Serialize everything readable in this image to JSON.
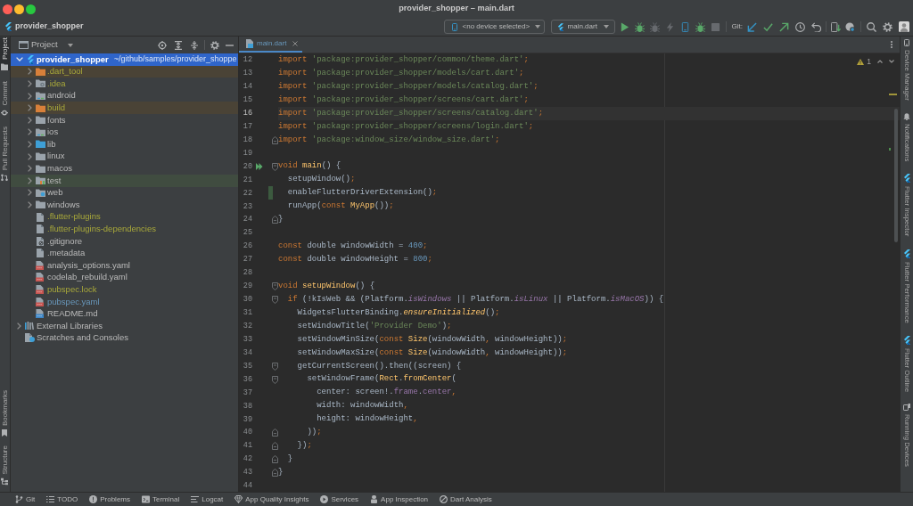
{
  "window": {
    "title": "provider_shopper – main.dart"
  },
  "toolbar": {
    "project_name": "provider_shopper",
    "device_selector": "<no device selected>",
    "run_configuration": "main.dart",
    "run_actions": [
      {
        "disabled": false
      },
      {
        "disabled": false
      },
      {
        "disabled": true
      },
      {
        "disabled": true
      },
      {
        "disabled": false
      },
      {
        "disabled": false
      },
      {
        "disabled": true
      }
    ],
    "git_label": "Git:"
  },
  "left_tool_strip": {
    "top": [
      {
        "label": "Project",
        "selected": true
      },
      {
        "label": "Commit",
        "selected": false
      },
      {
        "label": "Pull Requests",
        "selected": false
      }
    ],
    "bottom": [
      {
        "label": "Bookmarks",
        "selected": false
      },
      {
        "label": "Structure",
        "selected": false
      }
    ]
  },
  "project_panel": {
    "title": "Project",
    "tree": [
      {
        "name": "provider_shopper",
        "path": "~/github/samples/provider_shoppe",
        "kind": "module",
        "expanded": true,
        "selected": true,
        "children": [
          {
            "name": ".dart_tool",
            "kind": "excluded_folder",
            "ignored": true,
            "expanded": false,
            "selected": false
          },
          {
            "name": ".idea",
            "kind": "config_folder",
            "ignored": true,
            "expanded": false,
            "selected": false
          },
          {
            "name": "android",
            "kind": "module_folder",
            "expanded": false,
            "selected": false
          },
          {
            "name": "build",
            "kind": "excluded_folder",
            "ignored": true,
            "expanded": false,
            "selected": false
          },
          {
            "name": "fonts",
            "kind": "folder",
            "expanded": false,
            "selected": false
          },
          {
            "name": "ios",
            "kind": "module_folder",
            "expanded": false,
            "selected": false
          },
          {
            "name": "lib",
            "kind": "source_folder",
            "expanded": false,
            "selected": false
          },
          {
            "name": "linux",
            "kind": "folder",
            "expanded": false,
            "selected": false
          },
          {
            "name": "macos",
            "kind": "folder",
            "expanded": false,
            "selected": false
          },
          {
            "name": "test",
            "kind": "test_folder",
            "expanded": false,
            "selected": false
          },
          {
            "name": "web",
            "kind": "web_folder",
            "expanded": false,
            "selected": false
          },
          {
            "name": "windows",
            "kind": "folder",
            "expanded": false,
            "selected": false
          },
          {
            "name": ".flutter-plugins",
            "kind": "file",
            "ignored": true,
            "selected": false
          },
          {
            "name": ".flutter-plugins-dependencies",
            "kind": "file",
            "ignored": true,
            "selected": false
          },
          {
            "name": ".gitignore",
            "kind": "ignore_file",
            "selected": false
          },
          {
            "name": ".metadata",
            "kind": "file",
            "selected": false
          },
          {
            "name": "analysis_options.yaml",
            "kind": "yaml_file",
            "selected": false
          },
          {
            "name": "codelab_rebuild.yaml",
            "kind": "yaml_file",
            "selected": false
          },
          {
            "name": "pubspec.lock",
            "kind": "yaml_file",
            "ignored": true,
            "selected": false
          },
          {
            "name": "pubspec.yaml",
            "kind": "yaml_file",
            "modified": true,
            "selected": false
          },
          {
            "name": "README.md",
            "kind": "markdown_file",
            "selected": false
          }
        ]
      },
      {
        "name": "External Libraries",
        "kind": "libraries",
        "expanded": false,
        "selected": false
      },
      {
        "name": "Scratches and Consoles",
        "kind": "scratches",
        "selected": false
      }
    ]
  },
  "editor": {
    "tabs": [
      {
        "label": "main.dart",
        "selected": true,
        "modified": true
      }
    ],
    "warning_count": "1",
    "lines": [
      {
        "number": "12",
        "current": false,
        "tokens": [
          {
            "kind": "keyword",
            "text": "import "
          },
          {
            "kind": "string",
            "text": "'package:provider_shopper/common/theme.dart'"
          },
          {
            "kind": "punctuation",
            "text": ";"
          }
        ]
      },
      {
        "number": "13",
        "current": false,
        "tokens": [
          {
            "kind": "keyword",
            "text": "import "
          },
          {
            "kind": "string",
            "text": "'package:provider_shopper/models/cart.dart'"
          },
          {
            "kind": "punctuation",
            "text": ";"
          }
        ]
      },
      {
        "number": "14",
        "current": false,
        "tokens": [
          {
            "kind": "keyword",
            "text": "import "
          },
          {
            "kind": "string",
            "text": "'package:provider_shopper/models/catalog.dart'"
          },
          {
            "kind": "punctuation",
            "text": ";"
          }
        ]
      },
      {
        "number": "15",
        "current": false,
        "tokens": [
          {
            "kind": "keyword",
            "text": "import "
          },
          {
            "kind": "string",
            "text": "'package:provider_shopper/screens/cart.dart'"
          },
          {
            "kind": "punctuation",
            "text": ";"
          }
        ]
      },
      {
        "number": "16",
        "current": true,
        "tokens": [
          {
            "kind": "keyword",
            "text": "import "
          },
          {
            "kind": "string",
            "text": "'package:provider_shopper/screens/catalog.dart'"
          },
          {
            "kind": "punctuation",
            "text": ";"
          }
        ]
      },
      {
        "number": "17",
        "current": false,
        "tokens": [
          {
            "kind": "keyword",
            "text": "import "
          },
          {
            "kind": "string",
            "text": "'package:provider_shopper/screens/login.dart'"
          },
          {
            "kind": "punctuation",
            "text": ";"
          }
        ]
      },
      {
        "number": "18",
        "current": false,
        "fold_end": true,
        "tokens": [
          {
            "kind": "keyword",
            "text": "import "
          },
          {
            "kind": "string",
            "text": "'package:window_size/window_size.dart'"
          },
          {
            "kind": "punctuation",
            "text": ";"
          }
        ]
      },
      {
        "number": "19",
        "current": false
      },
      {
        "number": "20",
        "current": false,
        "fold_start": true,
        "run_marker": true,
        "tokens": [
          {
            "kind": "keyword",
            "text": "void "
          },
          {
            "kind": "declaration",
            "text": "main"
          },
          {
            "kind": "plain",
            "text": "() {"
          }
        ]
      },
      {
        "number": "21",
        "current": false,
        "tokens": [
          {
            "kind": "plain",
            "text": "  setupWindow()"
          },
          {
            "kind": "punctuation",
            "text": ";"
          }
        ]
      },
      {
        "number": "22",
        "current": false,
        "changed": true,
        "tokens": [
          {
            "kind": "plain",
            "text": "  enableFlutterDriverExtension()"
          },
          {
            "kind": "punctuation",
            "text": ";"
          }
        ]
      },
      {
        "number": "23",
        "current": false,
        "tokens": [
          {
            "kind": "plain",
            "text": "  runApp("
          },
          {
            "kind": "keyword",
            "text": "const "
          },
          {
            "kind": "type",
            "text": "MyApp"
          },
          {
            "kind": "plain",
            "text": "())"
          },
          {
            "kind": "punctuation",
            "text": ";"
          }
        ]
      },
      {
        "number": "24",
        "current": false,
        "fold_end": true,
        "tokens": [
          {
            "kind": "plain",
            "text": "}"
          }
        ]
      },
      {
        "number": "25",
        "current": false
      },
      {
        "number": "26",
        "current": false,
        "tokens": [
          {
            "kind": "keyword",
            "text": "const "
          },
          {
            "kind": "plain",
            "text": "double windowWidth = "
          },
          {
            "kind": "number",
            "text": "400"
          },
          {
            "kind": "punctuation",
            "text": ";"
          }
        ]
      },
      {
        "number": "27",
        "current": false,
        "tokens": [
          {
            "kind": "keyword",
            "text": "const "
          },
          {
            "kind": "plain",
            "text": "double windowHeight = "
          },
          {
            "kind": "number",
            "text": "800"
          },
          {
            "kind": "punctuation",
            "text": ";"
          }
        ]
      },
      {
        "number": "28",
        "current": false
      },
      {
        "number": "29",
        "current": false,
        "fold_start": true,
        "tokens": [
          {
            "kind": "keyword",
            "text": "void "
          },
          {
            "kind": "declaration",
            "text": "setupWindow"
          },
          {
            "kind": "plain",
            "text": "() {"
          }
        ]
      },
      {
        "number": "30",
        "current": false,
        "fold_start": true,
        "tokens": [
          {
            "kind": "keyword",
            "text": "  if "
          },
          {
            "kind": "plain",
            "text": "(!kIsWeb && (Platform."
          },
          {
            "kind": "static_property",
            "text": "isWindows"
          },
          {
            "kind": "plain",
            "text": " || Platform."
          },
          {
            "kind": "static_property",
            "text": "isLinux"
          },
          {
            "kind": "plain",
            "text": " || Platform."
          },
          {
            "kind": "static_property",
            "text": "isMacOS"
          },
          {
            "kind": "plain",
            "text": ")) {"
          }
        ]
      },
      {
        "number": "31",
        "current": false,
        "tokens": [
          {
            "kind": "plain",
            "text": "    WidgetsFlutterBinding."
          },
          {
            "kind": "static_method",
            "text": "ensureInitialized"
          },
          {
            "kind": "plain",
            "text": "()"
          },
          {
            "kind": "punctuation",
            "text": ";"
          }
        ]
      },
      {
        "number": "32",
        "current": false,
        "tokens": [
          {
            "kind": "plain",
            "text": "    setWindowTitle("
          },
          {
            "kind": "string",
            "text": "'Provider Demo'"
          },
          {
            "kind": "plain",
            "text": ")"
          },
          {
            "kind": "punctuation",
            "text": ";"
          }
        ]
      },
      {
        "number": "33",
        "current": false,
        "tokens": [
          {
            "kind": "plain",
            "text": "    setWindowMinSize("
          },
          {
            "kind": "keyword",
            "text": "const "
          },
          {
            "kind": "type",
            "text": "Size"
          },
          {
            "kind": "plain",
            "text": "(windowWidth"
          },
          {
            "kind": "punctuation",
            "text": ","
          },
          {
            "kind": "plain",
            "text": " windowHeight))"
          },
          {
            "kind": "punctuation",
            "text": ";"
          }
        ]
      },
      {
        "number": "34",
        "current": false,
        "tokens": [
          {
            "kind": "plain",
            "text": "    setWindowMaxSize("
          },
          {
            "kind": "keyword",
            "text": "const "
          },
          {
            "kind": "type",
            "text": "Size"
          },
          {
            "kind": "plain",
            "text": "(windowWidth"
          },
          {
            "kind": "punctuation",
            "text": ","
          },
          {
            "kind": "plain",
            "text": " windowHeight))"
          },
          {
            "kind": "punctuation",
            "text": ";"
          }
        ]
      },
      {
        "number": "35",
        "current": false,
        "fold_start": true,
        "tokens": [
          {
            "kind": "plain",
            "text": "    getCurrentScreen().then((screen) {"
          }
        ]
      },
      {
        "number": "36",
        "current": false,
        "fold_start": true,
        "tokens": [
          {
            "kind": "plain",
            "text": "      setWindowFrame("
          },
          {
            "kind": "type",
            "text": "Rect"
          },
          {
            "kind": "plain",
            "text": "."
          },
          {
            "kind": "type",
            "text": "fromCenter"
          },
          {
            "kind": "plain",
            "text": "("
          }
        ]
      },
      {
        "number": "37",
        "current": false,
        "tokens": [
          {
            "kind": "plain",
            "text": "        center: screen!."
          },
          {
            "kind": "property",
            "text": "frame"
          },
          {
            "kind": "plain",
            "text": "."
          },
          {
            "kind": "property",
            "text": "center"
          },
          {
            "kind": "punctuation",
            "text": ","
          }
        ]
      },
      {
        "number": "38",
        "current": false,
        "tokens": [
          {
            "kind": "plain",
            "text": "        width: windowWidth"
          },
          {
            "kind": "punctuation",
            "text": ","
          }
        ]
      },
      {
        "number": "39",
        "current": false,
        "tokens": [
          {
            "kind": "plain",
            "text": "        height: windowHeight"
          },
          {
            "kind": "punctuation",
            "text": ","
          }
        ]
      },
      {
        "number": "40",
        "current": false,
        "fold_end": true,
        "tokens": [
          {
            "kind": "plain",
            "text": "      ))"
          },
          {
            "kind": "punctuation",
            "text": ";"
          }
        ]
      },
      {
        "number": "41",
        "current": false,
        "fold_end": true,
        "tokens": [
          {
            "kind": "plain",
            "text": "    })"
          },
          {
            "kind": "punctuation",
            "text": ";"
          }
        ]
      },
      {
        "number": "42",
        "current": false,
        "fold_end": true,
        "tokens": [
          {
            "kind": "plain",
            "text": "  }"
          }
        ]
      },
      {
        "number": "43",
        "current": false,
        "fold_end": true,
        "tokens": [
          {
            "kind": "plain",
            "text": "}"
          }
        ]
      },
      {
        "number": "44",
        "current": false
      }
    ]
  },
  "right_tool_strip": [
    "Device Manager",
    "Notifications",
    "Flutter Inspector",
    "Flutter Performance",
    "Flutter Outline",
    "Running Devices"
  ],
  "bottom_tool_strip": [
    "Git",
    "TODO",
    "Problems",
    "Terminal",
    "Logcat",
    "App Quality Insights",
    "Services",
    "App Inspection",
    "Dart Analysis"
  ]
}
